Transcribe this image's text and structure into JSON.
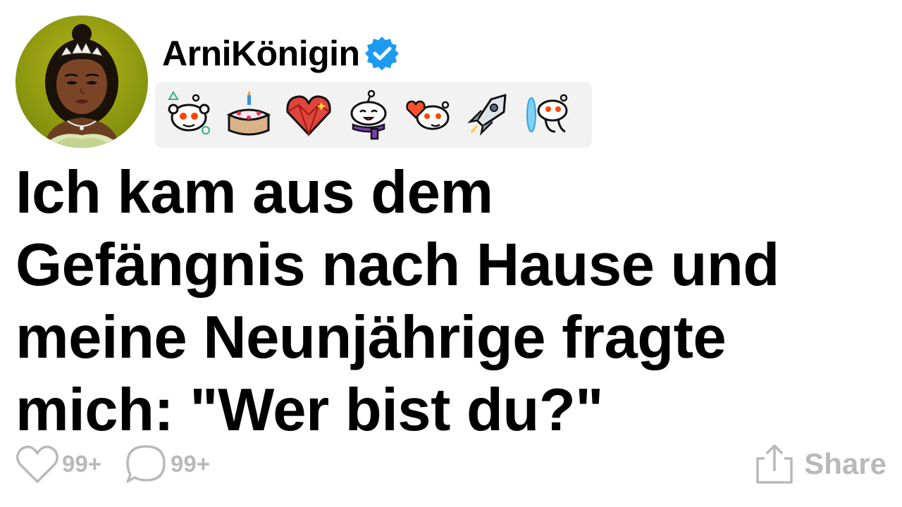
{
  "post": {
    "username": "ArniKönigin",
    "verified": true,
    "title_lines": [
      "Ich kam aus dem",
      "Gefängnis nach Hause und",
      "meine Neunjährige fragte",
      "mich: \"Wer bist du?\""
    ],
    "likes": "99+",
    "comments": "99+",
    "share_label": "Share"
  },
  "badges": [
    "snoo-shapes-badge-icon",
    "birthday-cake-badge-icon",
    "crystal-heart-badge-icon",
    "snoo-scarf-badge-icon",
    "snoo-heart-balloon-badge-icon",
    "rocket-badge-icon",
    "snoo-portal-badge-icon"
  ],
  "colors": {
    "verified": "#1d9bf0",
    "muted": "#b9b9b9",
    "badge_bg": "#f2f2f2",
    "avatar_bg": "#9aa114"
  }
}
